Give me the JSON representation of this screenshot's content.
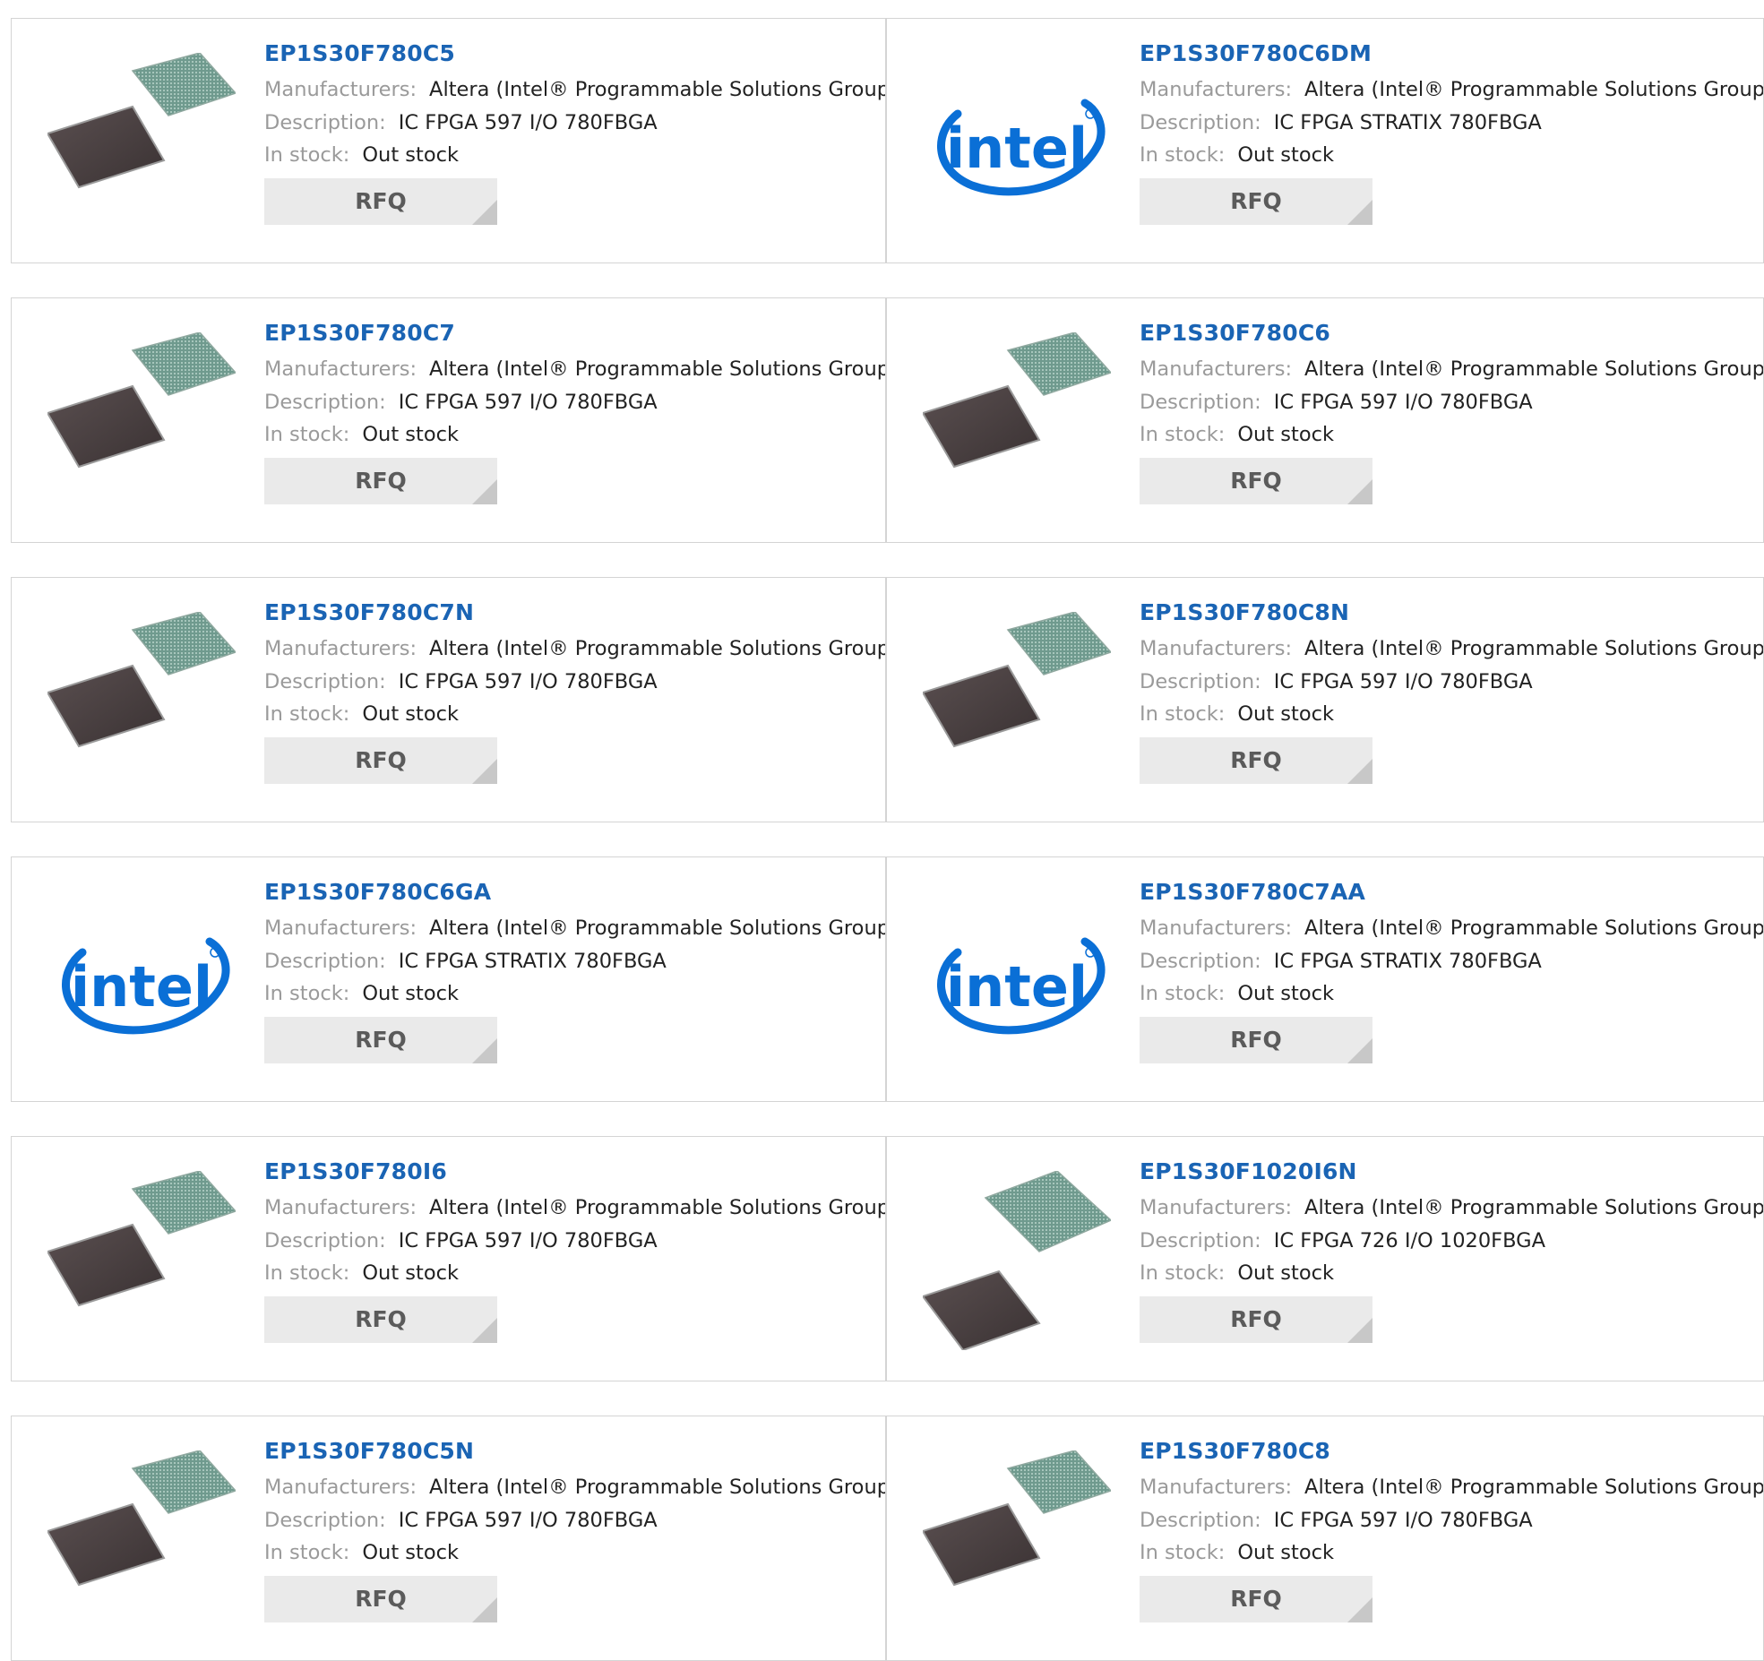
{
  "labels": {
    "manufacturers": "Manufacturers:",
    "description": "Description:",
    "in_stock": "In stock:",
    "rfq": "RFQ"
  },
  "colors": {
    "part_link": "#1a64b4",
    "intel_blue": "#0a6fd6",
    "button_bg": "#eaeaea"
  },
  "products": [
    {
      "part": "EP1S30F780C5",
      "manufacturer": "Altera (Intel® Programmable Solutions Group)",
      "description": "IC FPGA 597 I/O 780FBGA",
      "stock": "Out stock",
      "image": "fpga-chip-photo"
    },
    {
      "part": "EP1S30F780C6DM",
      "manufacturer": "Altera (Intel® Programmable Solutions Group)",
      "description": "IC FPGA STRATIX 780FBGA",
      "stock": "Out stock",
      "image": "intel-logo",
      "logo_text": "intel"
    },
    {
      "part": "EP1S30F780C7",
      "manufacturer": "Altera (Intel® Programmable Solutions Group)",
      "description": "IC FPGA 597 I/O 780FBGA",
      "stock": "Out stock",
      "image": "fpga-chip-photo"
    },
    {
      "part": "EP1S30F780C6",
      "manufacturer": "Altera (Intel® Programmable Solutions Group)",
      "description": "IC FPGA 597 I/O 780FBGA",
      "stock": "Out stock",
      "image": "fpga-chip-photo"
    },
    {
      "part": "EP1S30F780C7N",
      "manufacturer": "Altera (Intel® Programmable Solutions Group)",
      "description": "IC FPGA 597 I/O 780FBGA",
      "stock": "Out stock",
      "image": "fpga-chip-photo"
    },
    {
      "part": "EP1S30F780C8N",
      "manufacturer": "Altera (Intel® Programmable Solutions Group)",
      "description": "IC FPGA 597 I/O 780FBGA",
      "stock": "Out stock",
      "image": "fpga-chip-photo"
    },
    {
      "part": "EP1S30F780C6GA",
      "manufacturer": "Altera (Intel® Programmable Solutions Group)",
      "description": "IC FPGA STRATIX 780FBGA",
      "stock": "Out stock",
      "image": "intel-logo",
      "logo_text": "intel"
    },
    {
      "part": "EP1S30F780C7AA",
      "manufacturer": "Altera (Intel® Programmable Solutions Group)",
      "description": "IC FPGA STRATIX 780FBGA",
      "stock": "Out stock",
      "image": "intel-logo",
      "logo_text": "intel"
    },
    {
      "part": "EP1S30F780I6",
      "manufacturer": "Altera (Intel® Programmable Solutions Group)",
      "description": "IC FPGA 597 I/O 780FBGA",
      "stock": "Out stock",
      "image": "fpga-chip-photo"
    },
    {
      "part": "EP1S30F1020I6N",
      "manufacturer": "Altera (Intel® Programmable Solutions Group)",
      "description": "IC FPGA 726 I/O 1020FBGA",
      "stock": "Out stock",
      "image": "fpga-chip-photo-large"
    },
    {
      "part": "EP1S30F780C5N",
      "manufacturer": "Altera (Intel® Programmable Solutions Group)",
      "description": "IC FPGA 597 I/O 780FBGA",
      "stock": "Out stock",
      "image": "fpga-chip-photo"
    },
    {
      "part": "EP1S30F780C8",
      "manufacturer": "Altera (Intel® Programmable Solutions Group)",
      "description": "IC FPGA 597 I/O 780FBGA",
      "stock": "Out stock",
      "image": "fpga-chip-photo"
    }
  ]
}
